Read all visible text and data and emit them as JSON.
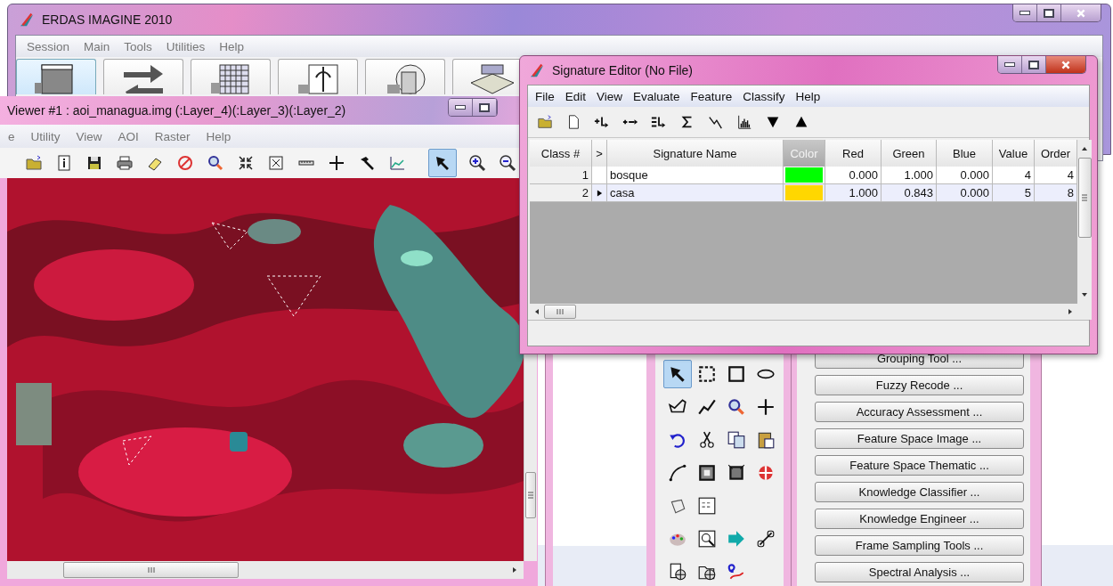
{
  "main_window": {
    "title": "ERDAS IMAGINE 2010",
    "menu": [
      "Session",
      "Main",
      "Tools",
      "Utilities",
      "Help"
    ]
  },
  "viewer": {
    "title": "Viewer #1 : aoi_managua.img (:Layer_4)(:Layer_3)(:Layer_2)",
    "menu": [
      "e",
      "Utility",
      "View",
      "AOI",
      "Raster",
      "Help"
    ],
    "image": {
      "kind": "picture"
    },
    "toolbar": [
      {
        "selected": false
      },
      {
        "selected": false
      },
      {
        "selected": false
      },
      {
        "selected": false
      },
      {
        "selected": false
      },
      {
        "selected": false
      },
      {
        "selected": false
      },
      {
        "selected": false
      },
      {
        "selected": false
      },
      {
        "selected": false
      },
      {
        "selected": false
      },
      {
        "selected": false
      },
      {
        "selected": false
      },
      {
        "selected": true
      },
      {
        "selected": false
      },
      {
        "selected": false
      }
    ]
  },
  "signature_editor": {
    "title": "Signature Editor (No File)",
    "menu": [
      "File",
      "Edit",
      "View",
      "Evaluate",
      "Feature",
      "Classify",
      "Help"
    ],
    "columns": [
      {
        "label": "Class #",
        "disabled": false
      },
      {
        "label": ">",
        "disabled": false
      },
      {
        "label": "Signature Name",
        "disabled": false
      },
      {
        "label": "Color",
        "disabled": true
      },
      {
        "label": "Red",
        "disabled": false
      },
      {
        "label": "Green",
        "disabled": false
      },
      {
        "label": "Blue",
        "disabled": false
      },
      {
        "label": "Value",
        "disabled": false
      },
      {
        "label": "Order",
        "disabled": false
      }
    ],
    "rows": [
      {
        "class": "1",
        "name": "bosque",
        "color": "#00ff00",
        "red": "0.000",
        "green": "1.000",
        "blue": "0.000",
        "value": "4",
        "order": "4",
        "selected": false
      },
      {
        "class": "2",
        "name": "casa",
        "color": "#ffd700",
        "red": "1.000",
        "green": "0.843",
        "blue": "0.000",
        "value": "5",
        "order": "8",
        "selected": true
      }
    ]
  },
  "tool_palette": {
    "tools": [
      {
        "selected": true
      },
      {
        "selected": false
      },
      {
        "selected": false
      },
      {
        "selected": false
      },
      {
        "selected": false
      },
      {
        "selected": false
      },
      {
        "selected": false
      },
      {
        "selected": false
      },
      {
        "selected": false
      },
      {
        "selected": false
      },
      {
        "selected": false
      },
      {
        "selected": false
      },
      {
        "selected": false
      },
      {
        "selected": false
      },
      {
        "selected": false
      },
      {
        "selected": false
      },
      {
        "selected": false
      },
      {
        "selected": false
      },
      {
        "selected": false
      },
      {
        "selected": false
      },
      {
        "selected": false
      },
      {
        "selected": false
      },
      {
        "selected": false
      },
      {
        "selected": false
      },
      {
        "selected": false
      }
    ]
  },
  "classification_buttons": [
    "Grouping Tool ...",
    "Fuzzy Recode ...",
    "Accuracy Assessment ...",
    "Feature Space Image ...",
    "Feature Space Thematic ...",
    "Knowledge Classifier ...",
    "Knowledge Engineer ...",
    "Frame Sampling Tools ...",
    "Spectral Analysis ..."
  ]
}
